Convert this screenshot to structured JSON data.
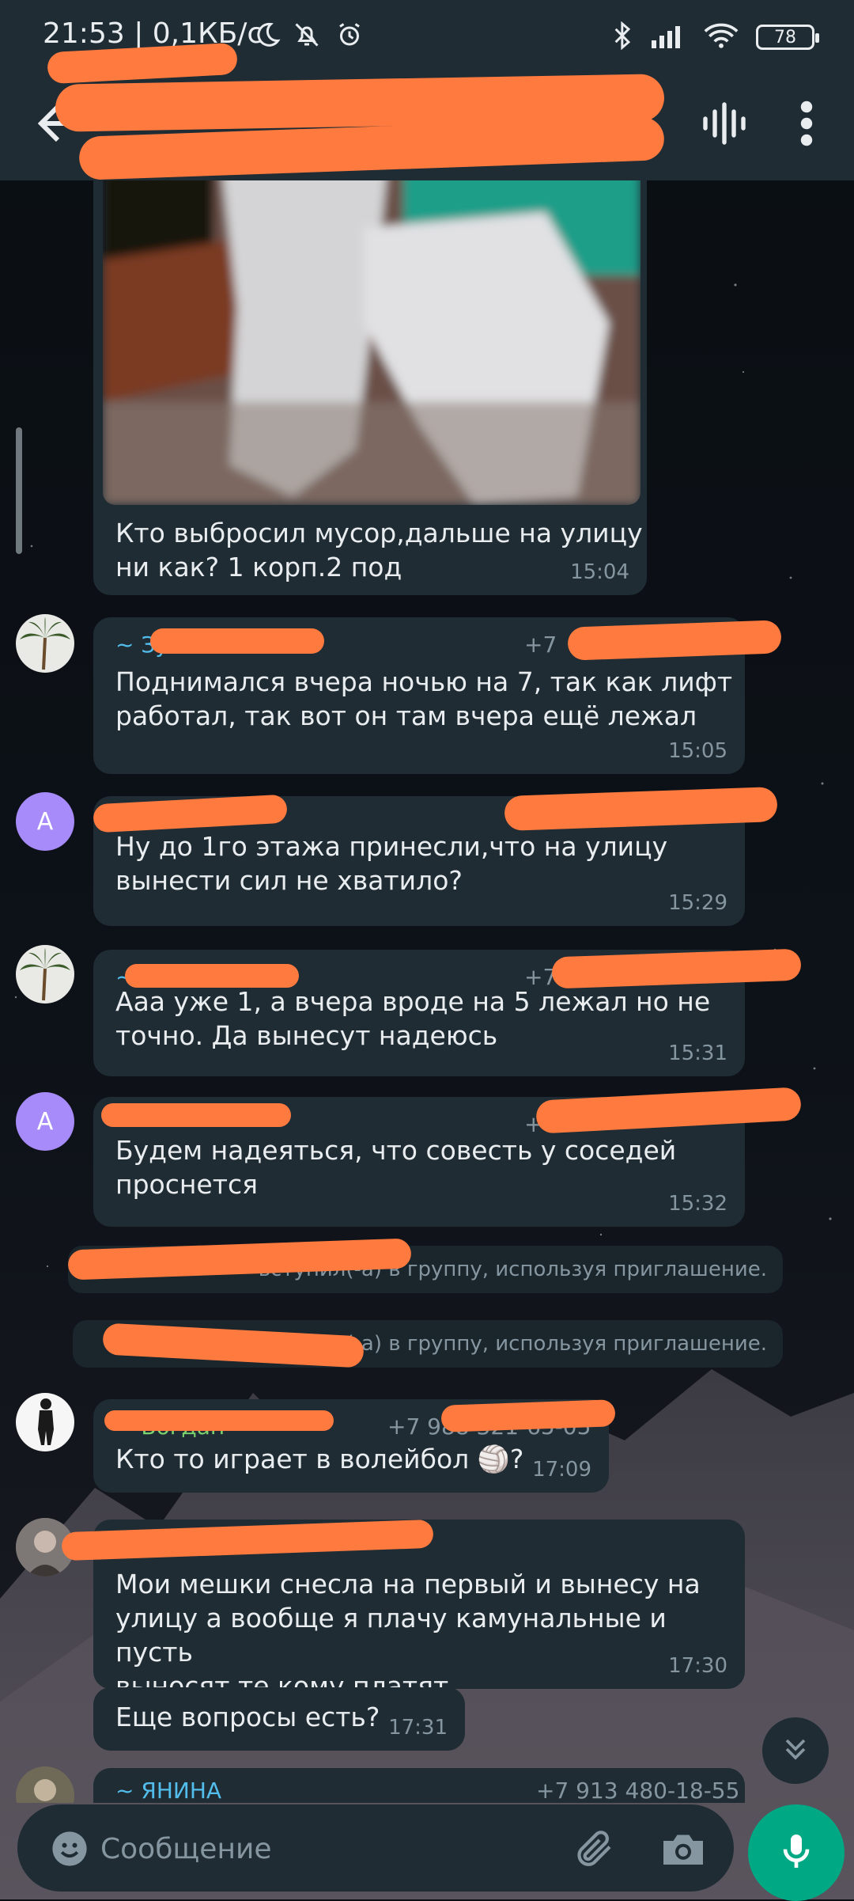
{
  "status_bar": {
    "time": "21:53 | 0,1КБ/с",
    "battery": "78"
  },
  "header": {
    "title": ""
  },
  "messages": [
    {
      "text": "Кто выбросил мусор,дальше на улицу\nни как? 1 корп.2 под",
      "time": "15:04"
    },
    {
      "sender": "~ Зуб",
      "phone": "+7",
      "text": "Поднимался вчера ночью на 7, так как лифт\nработал,  так вот он там вчера ещё лежал",
      "time": "15:05"
    },
    {
      "avatar_letter": "A",
      "text": "Ну до 1го этажа принесли,что на улицу\nвынести сил не хватило?",
      "time": "15:29"
    },
    {
      "sender": "~",
      "phone": "+7",
      "text": "Ааа уже 1, а вчера вроде на 5 лежал но не\nточно. Да вынесут надеюсь",
      "time": "15:31"
    },
    {
      "avatar_letter": "A",
      "phone": "+",
      "text": "Будем надеяться, что совесть у соседей\nпроснется",
      "time": "15:32"
    },
    {
      "sender": "~ Богдан",
      "phone": "+7 988 321-65-05",
      "text": "Кто то играет в волейбол 🏐?",
      "time": "17:09"
    },
    {
      "text": "Мои мешки снесла на первый и вынесу на\nулицу а вообще я плачу камунальные и пусть\nвыносят те кому платят",
      "time": "17:30"
    },
    {
      "text": "Еще вопросы есть?",
      "time": "17:31"
    },
    {
      "sender": "~ ЯНИНА",
      "phone": "+7 913 480-18-55"
    }
  ],
  "system_messages": [
    "вступил(-а) в группу, используя приглашение.",
    "пил(-а) в группу, используя приглашение."
  ],
  "input": {
    "placeholder": "Сообщение"
  },
  "colors": {
    "header_bg": "#1f2c34",
    "bubble_bg": "#1f2c34",
    "accent": "#00a884",
    "sender": "#53bdeb",
    "redaction": "#ff7a3f"
  }
}
